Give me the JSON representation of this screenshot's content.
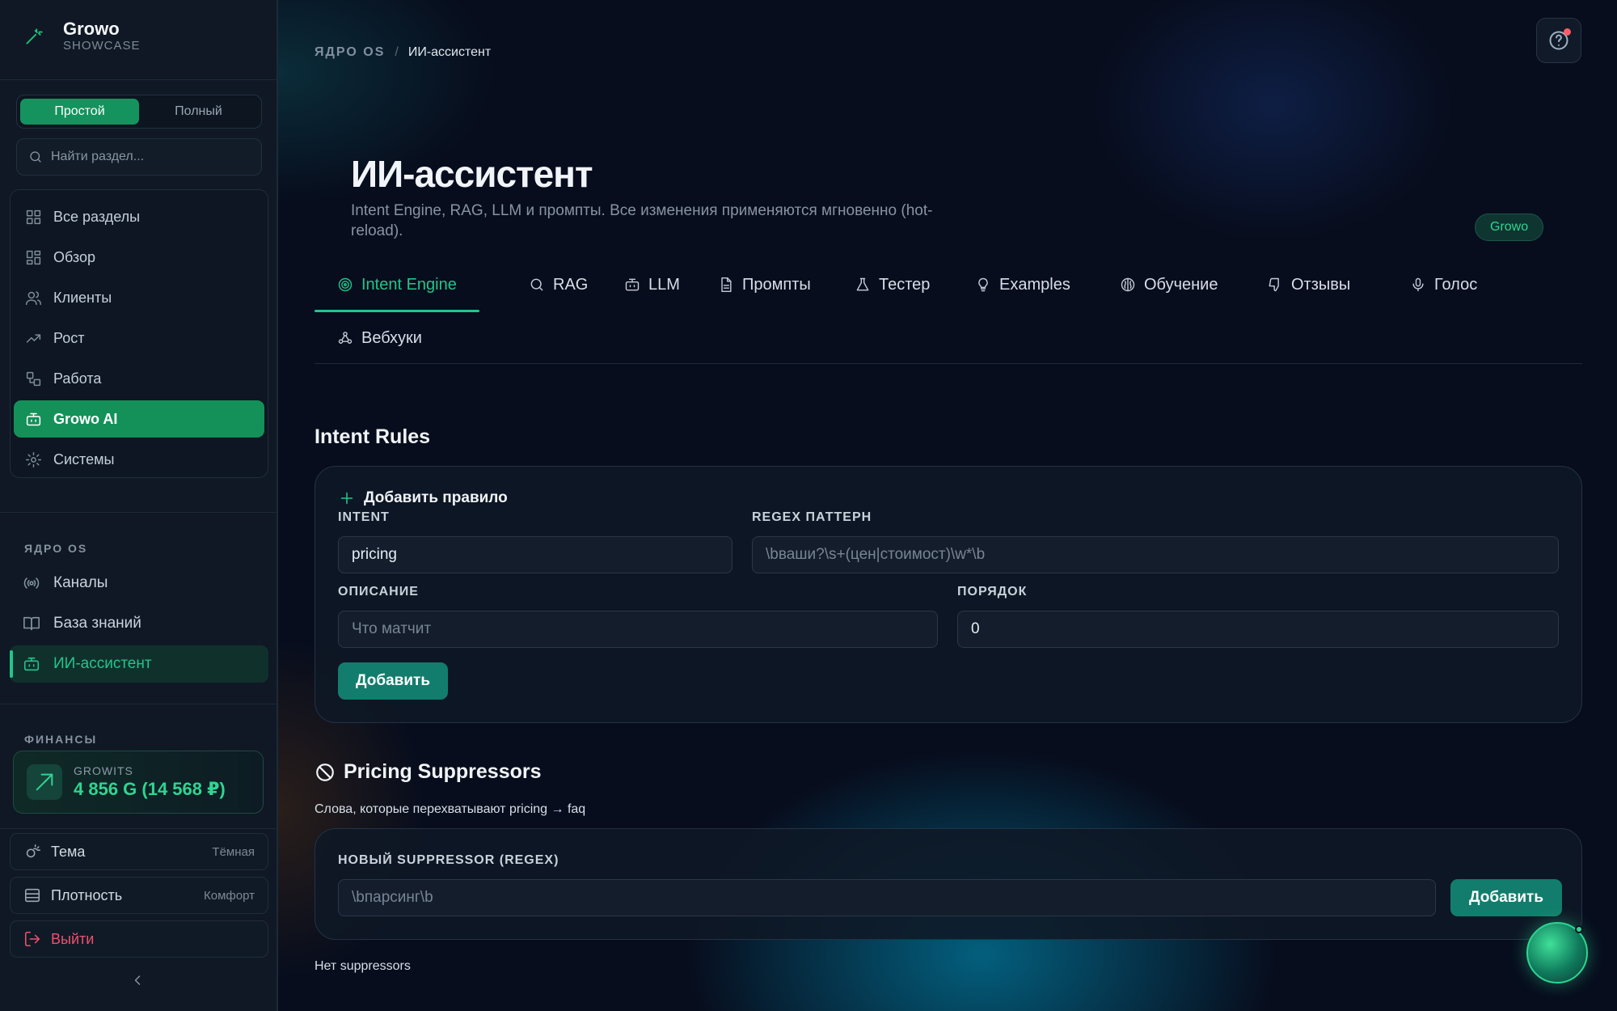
{
  "brand": {
    "name": "Growo",
    "subtitle": "SHOWCASE"
  },
  "mode_toggle": {
    "simple": "Простой",
    "full": "Полный",
    "selected": "Простой"
  },
  "sidebar_search": {
    "placeholder": "Найти раздел..."
  },
  "nav": [
    {
      "label": "Все разделы",
      "icon": "grid-icon",
      "active": false
    },
    {
      "label": "Обзор",
      "icon": "dashboard-icon",
      "active": false
    },
    {
      "label": "Клиенты",
      "icon": "users-icon",
      "active": false
    },
    {
      "label": "Рост",
      "icon": "trending-up-icon",
      "active": false
    },
    {
      "label": "Работа",
      "icon": "workflow-icon",
      "active": false
    },
    {
      "label": "Growo AI",
      "icon": "bot-icon",
      "active": true
    },
    {
      "label": "Системы",
      "icon": "gear-icon",
      "active": false
    }
  ],
  "core_os": {
    "label": "ЯДРО OS",
    "items": [
      {
        "label": "Каналы",
        "icon": "radio-icon"
      },
      {
        "label": "База знаний",
        "icon": "book-icon"
      },
      {
        "label": "ИИ-ассистент",
        "icon": "bot-icon",
        "current": true
      }
    ]
  },
  "finance": {
    "label": "ФИНАНСЫ",
    "wallet_label": "GROWITS",
    "wallet_value": "4 856 G (14 568 ₽)"
  },
  "settings": {
    "theme": {
      "label": "Тема",
      "value": "Тёмная"
    },
    "density": {
      "label": "Плотность",
      "value": "Комфорт"
    },
    "logout": "Выйти"
  },
  "breadcrumb": {
    "root": "ЯДРО OS",
    "separator": "/",
    "current": "ИИ-ассистент"
  },
  "page": {
    "title": "ИИ-ассистент",
    "subtitle": "Intent Engine, RAG, LLM и промпты. Все изменения применяются мгновенно (hot-reload).",
    "badge": "Growo"
  },
  "tabs": [
    {
      "label": "Intent Engine",
      "icon": "target-icon",
      "active": true
    },
    {
      "label": "RAG",
      "icon": "search-icon"
    },
    {
      "label": "LLM",
      "icon": "bot-icon"
    },
    {
      "label": "Промпты",
      "icon": "document-icon"
    },
    {
      "label": "Тестер",
      "icon": "flask-icon"
    },
    {
      "label": "Examples",
      "icon": "lightbulb-icon"
    },
    {
      "label": "Обучение",
      "icon": "brain-icon"
    },
    {
      "label": "Отзывы",
      "icon": "thumbs-down-icon"
    },
    {
      "label": "Голос",
      "icon": "mic-icon"
    },
    {
      "label": "Вебхуки",
      "icon": "webhook-icon"
    }
  ],
  "intent_rules": {
    "title": "Intent Rules",
    "form": {
      "title": "Добавить правило",
      "intent_label": "INTENT",
      "intent_value": "pricing",
      "regex_label": "REGEX ПАТТЕРН",
      "regex_placeholder": "\\bваши?\\s+(цен|стоимост)\\w*\\b",
      "desc_label": "ОПИСАНИЕ",
      "desc_placeholder": "Что матчит",
      "order_label": "ПОРЯДОК",
      "order_value": "0",
      "submit": "Добавить"
    }
  },
  "suppressors": {
    "title": "Pricing Suppressors",
    "description": "Слова, которые перехватывают pricing → faq",
    "new_label": "НОВЫЙ SUPPRESSOR (REGEX)",
    "new_placeholder": "\\bпарсинг\\b",
    "submit": "Добавить",
    "empty": "Нет suppressors"
  },
  "colors": {
    "accent": "#22c58a",
    "active_bg": "#139159",
    "button": "#127d6c",
    "danger": "#f0506e"
  }
}
